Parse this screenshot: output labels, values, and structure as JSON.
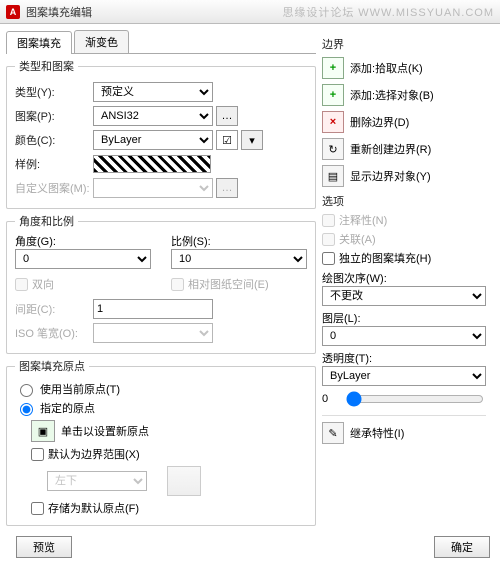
{
  "window": {
    "title": "图案填充编辑",
    "watermark1": "思缘设计论坛",
    "watermark2": "WWW.MISSYUAN.COM"
  },
  "tabs": {
    "hatch": "图案填充",
    "gradient": "渐变色"
  },
  "typePattern": {
    "legend": "类型和图案",
    "typeLabel": "类型(Y):",
    "typeValue": "预定义",
    "patternLabel": "图案(P):",
    "patternValue": "ANSI32",
    "colorLabel": "颜色(C):",
    "colorValue": "ByLayer",
    "sampleLabel": "样例:",
    "customLabel": "自定义图案(M):"
  },
  "angleScale": {
    "legend": "角度和比例",
    "angleLabel": "角度(G):",
    "angleValue": "0",
    "scaleLabel": "比例(S):",
    "scaleValue": "10",
    "double": "双向",
    "paperSpace": "相对图纸空间(E)",
    "spacingLabel": "间距(C):",
    "spacingValue": "1",
    "isoPenLabel": "ISO 笔宽(O):"
  },
  "origin": {
    "legend": "图案填充原点",
    "useCurrent": "使用当前原点(T)",
    "useSpecified": "指定的原点",
    "clickSet": "单击以设置新原点",
    "defaultExtent": "默认为边界范围(X)",
    "extentValue": "左下",
    "store": "存储为默认原点(F)"
  },
  "boundary": {
    "title": "边界",
    "addPick": "添加:拾取点(K)",
    "addSelect": "添加:选择对象(B)",
    "remove": "删除边界(D)",
    "recreate": "重新创建边界(R)",
    "show": "显示边界对象(Y)"
  },
  "options": {
    "title": "选项",
    "annotative": "注释性(N)",
    "associative": "关联(A)",
    "independent": "独立的图案填充(H)",
    "drawOrderLabel": "绘图次序(W):",
    "drawOrderValue": "不更改",
    "layerLabel": "图层(L):",
    "layerValue": "0",
    "transparencyLabel": "透明度(T):",
    "transparencyValue": "ByLayer",
    "transparencyNum": "0"
  },
  "inherit": "继承特性(I)",
  "footer": {
    "preview": "预览",
    "ok": "确定"
  }
}
